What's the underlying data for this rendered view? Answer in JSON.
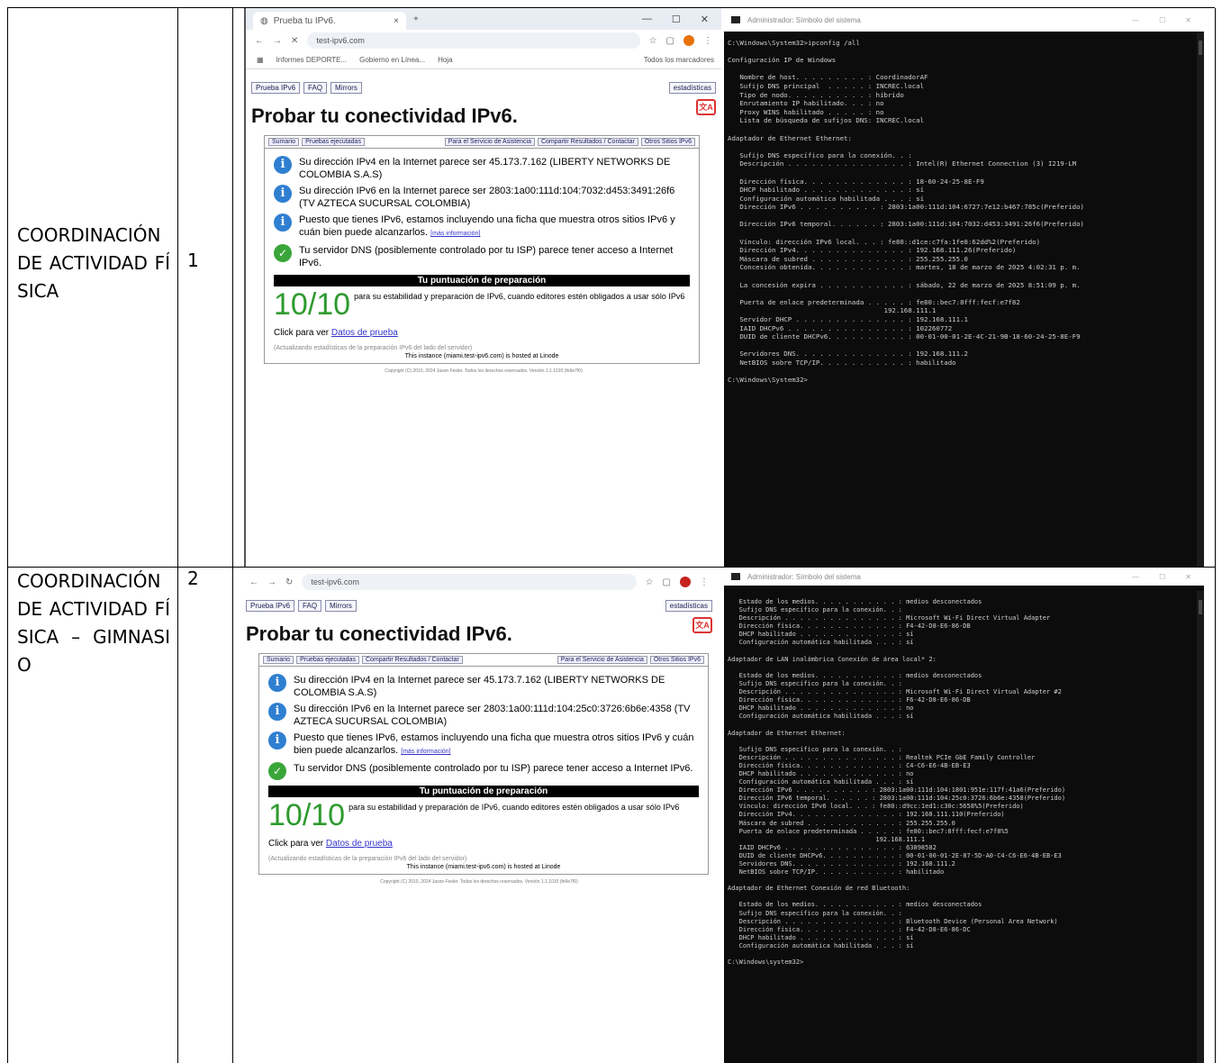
{
  "rows": [
    {
      "label": "COORDINACIÓN DE ACTIVIDAD FÍSICA",
      "number": "1",
      "browser": {
        "tab_title": "Prueba tu IPv6.",
        "url": "test-ipv6.com",
        "bookmarks": [
          "Informes DEPORTE...",
          "Gobierno en Línea...",
          "Hoja",
          "Todos los marcadores"
        ],
        "nav_tabs": [
          "Prueba IPv6",
          "FAQ",
          "Mirrors"
        ],
        "stats_tab": "estadísticas",
        "title": "Probar tu conectividad IPv6.",
        "sub_tabs": [
          "Sumario",
          "Pruebas ejecutadas",
          "Compartir Resultados / Contactar",
          "Otros Sitios IPv6"
        ],
        "help_tab": "Para el Servicio de Asistencia",
        "messages": [
          {
            "icon": "info",
            "text": "Su dirección IPv4 en la Internet parece ser 45.173.7.162 (LIBERTY NETWORKS DE COLOMBIA S.A.S)"
          },
          {
            "icon": "info",
            "text": "Su dirección IPv6 en la Internet parece ser 2803:1a00:111d:104:7032:d453:3491:26f6 (TV AZTECA SUCURSAL COLOMBIA)"
          },
          {
            "icon": "info",
            "text": "Puesto que tienes IPv6, estamos incluyendo una ficha que muestra otros sitios IPv6 y cuán bien puede alcanzarlos.",
            "link": "[más información]"
          },
          {
            "icon": "ok",
            "text": "Tu servidor DNS (posiblemente controlado por tu ISP) parece tener acceso a Internet IPv6."
          }
        ],
        "score_heading": "Tu puntuación de preparación",
        "score": "10/10",
        "score_desc": "para su estabilidad y preparación de IPv6, cuando editores estén obligados a usar sólo IPv6",
        "click_prefix": "Click para ver",
        "click_link": "Datos de prueba",
        "updating": "(Actualizando estadísticas de la preparación IPv6 del lado del servidor)",
        "hosted": "This instance (miami.test-ipv6.com) is hosted at Linode",
        "footer": "Copyright (C) 2010, 2024 Jason Fesler. Todos los derechos reservados. Versión 1.1.1010 (fe9e7f0)"
      },
      "terminal": {
        "title": "Administrador: Símbolo del sistema",
        "lines": [
          "C:\\Windows\\System32>ipconfig /all",
          "",
          "Configuración IP de Windows",
          "",
          "   Nombre de host. . . . . . . . . : CoordinadorAF",
          "   Sufijo DNS principal  . . . . . : INCREC.local",
          "   Tipo de nodo. . . . . . . . . . : híbrido",
          "   Enrutamiento IP habilitado. . . : no",
          "   Proxy WINS habilitado . . . . . : no",
          "   Lista de búsqueda de sufijos DNS: INCREC.local",
          "",
          "Adaptador de Ethernet Ethernet:",
          "",
          "   Sufijo DNS específico para la conexión. . :",
          "   Descripción . . . . . . . . . . . . . . . : Intel(R) Ethernet Connection (3) I219-LM",
          "",
          "   Dirección física. . . . . . . . . . . . . : 18-60-24-25-8E-F9",
          "   DHCP habilitado . . . . . . . . . . . . . : sí",
          "   Configuración automática habilitada . . . : sí",
          "   Dirección IPv6 . . . . . . . . . . : 2803:1a00:111d:104:6727:7e12:b467:785c(Preferido)",
          "",
          "   Dirección IPv6 temporal. . . . . . : 2803:1a00:111d:104:7032:d453:3491:26f6(Preferido)",
          "",
          "   Vínculo: dirección IPv6 local. . . : fe80::d1ce:c7fa:1fe8:62dd%2(Preferido)",
          "   Dirección IPv4. . . . . . . . . . . . . . : 192.168.111.26(Preferido)",
          "   Máscara de subred . . . . . . . . . . . . : 255.255.255.0",
          "   Concesión obtenida. . . . . . . . . . . . : martes, 18 de marzo de 2025 4:02:31 p. m.",
          "",
          "   La concesión expira . . . . . . . . . . . : sábado, 22 de marzo de 2025 8:51:09 p. m.",
          "",
          "   Puerta de enlace predeterminada . . . . . : fe80::bec7:8fff:fecf:e7f82",
          "                                       192.168.111.1",
          "   Servidor DHCP . . . . . . . . . . . . . . : 192.168.111.1",
          "   IAID DHCPv6 . . . . . . . . . . . . . . . : 102260772",
          "   DUID de cliente DHCPv6. . . . . . . . . . : 00-01-00-01-2E-4C-21-9B-18-60-24-25-8E-F9",
          "",
          "   Servidores DNS. . . . . . . . . . . . . . : 192.168.111.2",
          "   NetBIOS sobre TCP/IP. . . . . . . . . . . : habilitado",
          "",
          "C:\\Windows\\System32>"
        ]
      }
    },
    {
      "label": "COORDINACIÓN DE ACTIVIDAD FÍSICA – GIMNASIO",
      "number": "2",
      "browser": {
        "url": "test-ipv6.com",
        "nav_tabs": [
          "Prueba IPv6",
          "FAQ",
          "Mirrors"
        ],
        "stats_tab": "estadísticas",
        "title": "Probar tu conectividad IPv6.",
        "sub_tabs": [
          "Sumario",
          "Pruebas ejecutadas",
          "Compartir Resultados / Contactar",
          "Otros Sitios IPv6"
        ],
        "help_tab": "Para el Servicio de Asistencia",
        "messages": [
          {
            "icon": "info",
            "text": "Su dirección IPv4 en la Internet parece ser 45.173.7.162 (LIBERTY NETWORKS DE COLOMBIA S.A.S)"
          },
          {
            "icon": "info",
            "text": "Su dirección IPv6 en la Internet parece ser 2803:1a00:111d:104:25c0:3726:6b6e:4358 (TV AZTECA SUCURSAL COLOMBIA)"
          },
          {
            "icon": "info",
            "text": "Puesto que tienes IPv6, estamos incluyendo una ficha que muestra otros sitios IPv6 y cuán bien puede alcanzarlos.",
            "link": "[más información]"
          },
          {
            "icon": "ok",
            "text": "Tu servidor DNS (posiblemente controlado por tu ISP) parece tener acceso a Internet IPv6."
          }
        ],
        "score_heading": "Tu puntuación de preparación",
        "score": "10/10",
        "score_desc": "para su estabilidad y preparación de IPv6, cuando editores estén obligados a usar sólo IPv6",
        "click_prefix": "Click para ver",
        "click_link": "Datos de prueba",
        "updating": "(Actualizando estadísticas de la preparación IPv6 del lado del servidor)",
        "hosted": "This instance (miami.test-ipv6.com) is hosted at Linode",
        "footer": "Copyright (C) 2010, 2024 Jason Fesler. Todos los derechos reservados. Versión 1.1.1010 (fe9e7f0)"
      },
      "terminal": {
        "title": "Administrador: Símbolo del sistema",
        "lines": [
          "   Estado de los medios. . . . . . . . . . . : medios desconectados",
          "   Sufijo DNS específico para la conexión. . :",
          "   Descripción . . . . . . . . . . . . . . . : Microsoft Wi-Fi Direct Virtual Adapter",
          "   Dirección física. . . . . . . . . . . . . : F4-42-D8-E6-86-DB",
          "   DHCP habilitado . . . . . . . . . . . . . : sí",
          "   Configuración automática habilitada . . . : sí",
          "",
          "Adaptador de LAN inalámbrica Conexión de área local* 2:",
          "",
          "   Estado de los medios. . . . . . . . . . . : medios desconectados",
          "   Sufijo DNS específico para la conexión. . :",
          "   Descripción . . . . . . . . . . . . . . . : Microsoft Wi-Fi Direct Virtual Adapter #2",
          "   Dirección física. . . . . . . . . . . . . : F6-42-D8-E6-86-DB",
          "   DHCP habilitado . . . . . . . . . . . . . : no",
          "   Configuración automática habilitada . . . : sí",
          "",
          "Adaptador de Ethernet Ethernet:",
          "",
          "   Sufijo DNS específico para la conexión. . :",
          "   Descripción . . . . . . . . . . . . . . . : Realtek PCIe GbE Family Controller",
          "   Dirección física. . . . . . . . . . . . . : C4-C6-E6-4B-EB-E3",
          "   DHCP habilitado . . . . . . . . . . . . . : no",
          "   Configuración automática habilitada . . . : sí",
          "   Dirección IPv6 . . . . . . . . . . : 2803:1a00:111d:104:1801:951e:117f:41a6(Preferido)",
          "   Dirección IPv6 temporal. . . . . . : 2803:1a00:111d:104:25c0:3726:6b6e:4358(Preferido)",
          "   Vínculo: dirección IPv6 local. . . : fe80::d9cc:1ed1:c30c:5658%5(Preferido)",
          "   Dirección IPv4. . . . . . . . . . . . . . : 192.168.111.110(Preferido)",
          "   Máscara de subred . . . . . . . . . . . . : 255.255.255.0",
          "   Puerta de enlace predeterminada . . . . . : fe80::bec7:8fff:fecf:e7f8%5",
          "                                       192.168.111.1",
          "   IAID DHCPv6 . . . . . . . . . . . . . . . : 63898582",
          "   DUID de cliente DHCPv6. . . . . . . . . . : 00-01-00-01-2E-87-5D-A0-C4-C6-E6-4B-EB-E3",
          "   Servidores DNS. . . . . . . . . . . . . . : 192.168.111.2",
          "   NetBIOS sobre TCP/IP. . . . . . . . . . . : habilitado",
          "",
          "Adaptador de Ethernet Conexión de red Bluetooth:",
          "",
          "   Estado de los medios. . . . . . . . . . . : medios desconectados",
          "   Sufijo DNS específico para la conexión. . :",
          "   Descripción . . . . . . . . . . . . . . . : Bluetooth Device (Personal Area Network)",
          "   Dirección física. . . . . . . . . . . . . : F4-42-D8-E6-86-DC",
          "   DHCP habilitado . . . . . . . . . . . . . : sí",
          "   Configuración automática habilitada . . . : sí",
          "",
          "C:\\Windows\\system32>"
        ]
      }
    }
  ]
}
